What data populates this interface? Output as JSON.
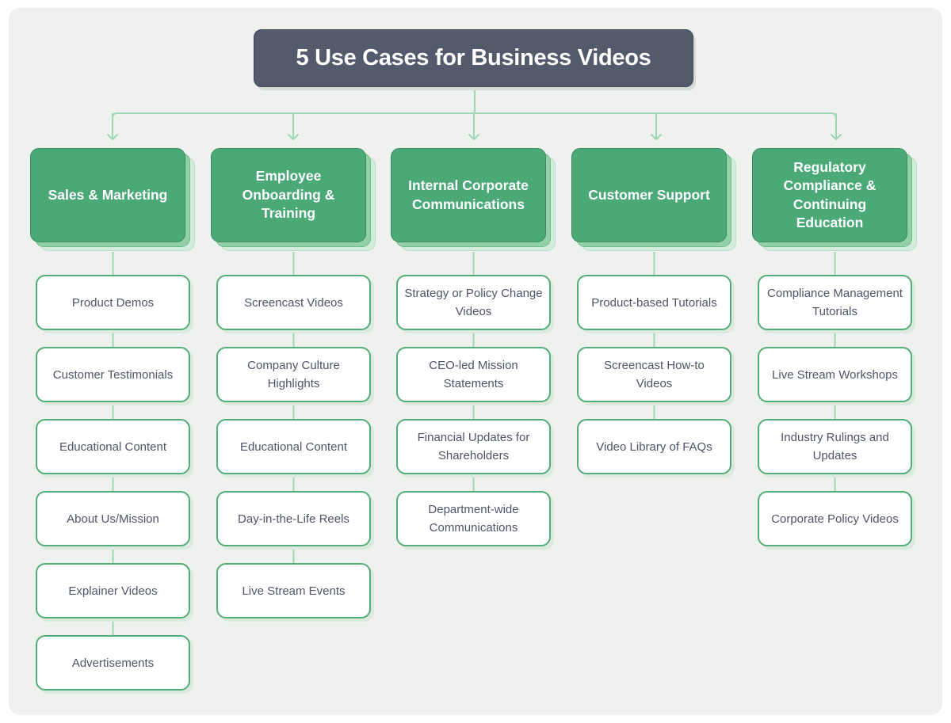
{
  "title": "5 Use Cases for Business Videos",
  "colors": {
    "title_bg": "#525a6c",
    "header_green": "#4aa977",
    "item_border": "#52ad78",
    "connector": "#9fd7b4",
    "item_text": "#4f5567",
    "panel_bg": "#eef1ee"
  },
  "categories": [
    {
      "label": "Sales & Marketing",
      "items": [
        "Product Demos",
        "Customer Testimonials",
        "Educational Content",
        "About Us/Mission",
        "Explainer Videos",
        "Advertisements"
      ]
    },
    {
      "label": "Employee Onboarding & Training",
      "items": [
        "Screencast Videos",
        "Company Culture Highlights",
        "Educational Content",
        "Day-in-the-Life Reels",
        "Live Stream Events"
      ]
    },
    {
      "label": "Internal Corporate Communications",
      "items": [
        "Strategy or Policy Change Videos",
        "CEO-led Mission Statements",
        "Financial Updates for Shareholders",
        "Department-wide Communications"
      ]
    },
    {
      "label": "Customer Support",
      "items": [
        "Product-based Tutorials",
        "Screencast How-to Videos",
        "Video Library of FAQs"
      ]
    },
    {
      "label": "Regulatory Compliance & Continuing Education",
      "items": [
        "Compliance Management Tutorials",
        "Live Stream Workshops",
        "Industry Rulings and Updates",
        "Corporate Policy Videos"
      ]
    }
  ]
}
